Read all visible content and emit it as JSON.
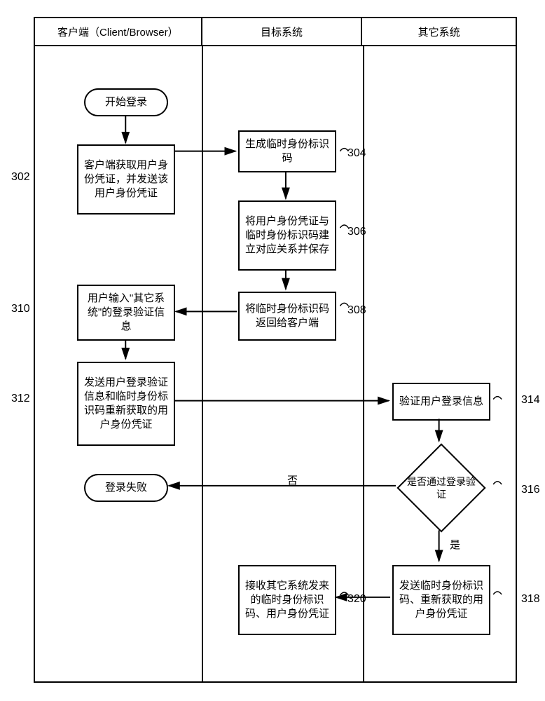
{
  "lanes": {
    "client": "客户端（Client/Browser）",
    "target": "目标系统",
    "other": "其它系统"
  },
  "nodes": {
    "start": "开始登录",
    "n302": "客户端获取用户身份凭证，并发送该用户身份凭证",
    "n304": "生成临时身份标识码",
    "n306": "将用户身份凭证与临时身份标识码建立对应关系并保存",
    "n308": "将临时身份标识码返回给客户端",
    "n310": "用户输入\"其它系统\"的登录验证信息",
    "n312": "发送用户登录验证信息和临时身份标识码重新获取的用户身份凭证",
    "n314": "验证用户登录信息",
    "n316": "是否通过登录验证",
    "fail": "登录失败",
    "n318": "发送临时身份标识码、重新获取的用户身份凭证",
    "n320": "接收其它系统发来的临时身份标识码、用户身份凭证"
  },
  "edges": {
    "no": "否",
    "yes": "是"
  },
  "refs": {
    "r302": "302",
    "r304": "304",
    "r306": "306",
    "r308": "308",
    "r310": "310",
    "r312": "312",
    "r314": "314",
    "r316": "316",
    "r318": "318",
    "r320": "320"
  }
}
